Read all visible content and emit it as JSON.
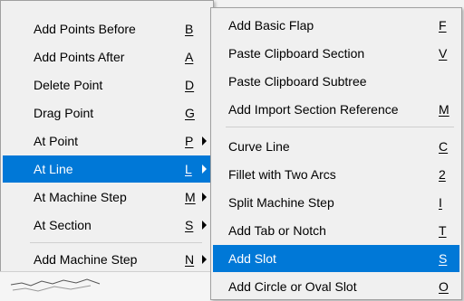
{
  "menu_left": {
    "items": [
      {
        "label": "Add Points Before",
        "key": "B"
      },
      {
        "label": "Add Points After",
        "key": "A"
      },
      {
        "label": "Delete Point",
        "key": "D"
      },
      {
        "label": "Drag Point",
        "key": "G"
      },
      {
        "label": "At Point",
        "key": "P",
        "submenu": true
      },
      {
        "label": "At Line",
        "key": "L",
        "submenu": true,
        "highlighted": true
      },
      {
        "label": "At Machine Step",
        "key": "M",
        "submenu": true
      },
      {
        "label": "At Section",
        "key": "S",
        "submenu": true
      },
      {
        "label": "Add Machine Step",
        "key": "N",
        "submenu": true
      }
    ]
  },
  "menu_right": {
    "items": [
      {
        "label": "Add Basic Flap",
        "key": "F"
      },
      {
        "label": "Paste Clipboard Section",
        "key": "V"
      },
      {
        "label": "Paste Clipboard Subtree",
        "key": ""
      },
      {
        "label": "Add Import Section Reference",
        "key": "M"
      },
      {
        "label": "Curve Line",
        "key": "C"
      },
      {
        "label": "Fillet with Two Arcs",
        "key": "2"
      },
      {
        "label": "Split Machine Step",
        "key": "I"
      },
      {
        "label": "Add Tab or Notch",
        "key": "T"
      },
      {
        "label": "Add Slot",
        "key": "S",
        "highlighted": true
      },
      {
        "label": "Add Circle or Oval Slot",
        "key": "O"
      }
    ]
  },
  "colors": {
    "highlight": "#0078d7",
    "menu_bg": "#f0f0f0"
  }
}
